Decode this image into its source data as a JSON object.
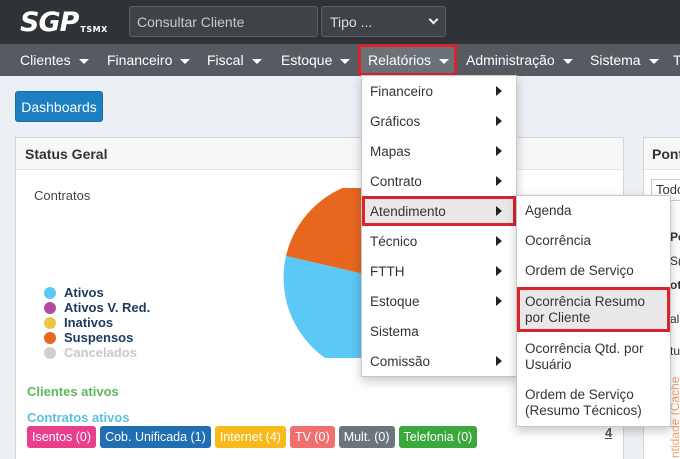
{
  "logo": {
    "main": "SGP",
    "sub": "TSMX"
  },
  "search": {
    "placeholder": "Consultar Cliente"
  },
  "tipo": {
    "value": "Tipo ..."
  },
  "nav": {
    "items": [
      "Clientes",
      "Financeiro",
      "Fiscal",
      "Estoque",
      "Relatórios",
      "Administração",
      "Sistema",
      "T"
    ]
  },
  "dashboards": "Dashboards",
  "status_panel": {
    "title": "Status Geral",
    "contratos": "Contratos",
    "legend": [
      {
        "label": "Ativos",
        "color": "#5bc8f5"
      },
      {
        "label": "Ativos V. Red.",
        "color": "#b24aa4"
      },
      {
        "label": "Inativos",
        "color": "#e6c841"
      },
      {
        "label": "Suspensos",
        "color": "#e8671e"
      },
      {
        "label": "Cancelados",
        "color": "#d0d0d0"
      }
    ],
    "clientes_ativos": "Clientes ativos",
    "contratos_ativos": "Contratos ativos",
    "badges": [
      {
        "label": "Isentos (0)",
        "color": "#e83e8c"
      },
      {
        "label": "Cob. Unificada (1)",
        "color": "#1f6fb2"
      },
      {
        "label": "Internet (4)",
        "color": "#f7b91c"
      },
      {
        "label": "TV (0)",
        "color": "#f07070"
      },
      {
        "label": "Mult. (0)",
        "color": "#6c757d"
      },
      {
        "label": "Telefonia (0)",
        "color": "#3aa83a"
      }
    ],
    "count": "4"
  },
  "right_panel": {
    "title": "Ponto",
    "select": "Todo",
    "snippets": [
      "Po",
      "S(",
      "ot",
      "al",
      "tu"
    ],
    "vertical": "ntidade (Cache"
  },
  "relatorios_menu": {
    "items": [
      {
        "label": "Financeiro",
        "submenu": true
      },
      {
        "label": "Gráficos",
        "submenu": true
      },
      {
        "label": "Mapas",
        "submenu": true
      },
      {
        "label": "Contrato",
        "submenu": true
      },
      {
        "label": "Atendimento",
        "submenu": true
      },
      {
        "label": "Técnico",
        "submenu": true
      },
      {
        "label": "FTTH",
        "submenu": true
      },
      {
        "label": "Estoque",
        "submenu": true
      },
      {
        "label": "Sistema",
        "submenu": false
      },
      {
        "label": "Comissão",
        "submenu": true
      }
    ]
  },
  "atendimento_submenu": {
    "items": [
      "Agenda",
      "Ocorrência",
      "Ordem de Serviço",
      "Ocorrência Resumo por Cliente",
      "Ocorrência Qtd. por Usuário",
      "Ordem de Serviço (Resumo Técnicos)"
    ]
  },
  "colors": {
    "topbar": "#2f3336",
    "navbar": "#555b61",
    "highlight": "#d9232d",
    "primary": "#1b7fc2",
    "section_title": "#5cb85c",
    "section_title_2": "#5bc0de"
  }
}
